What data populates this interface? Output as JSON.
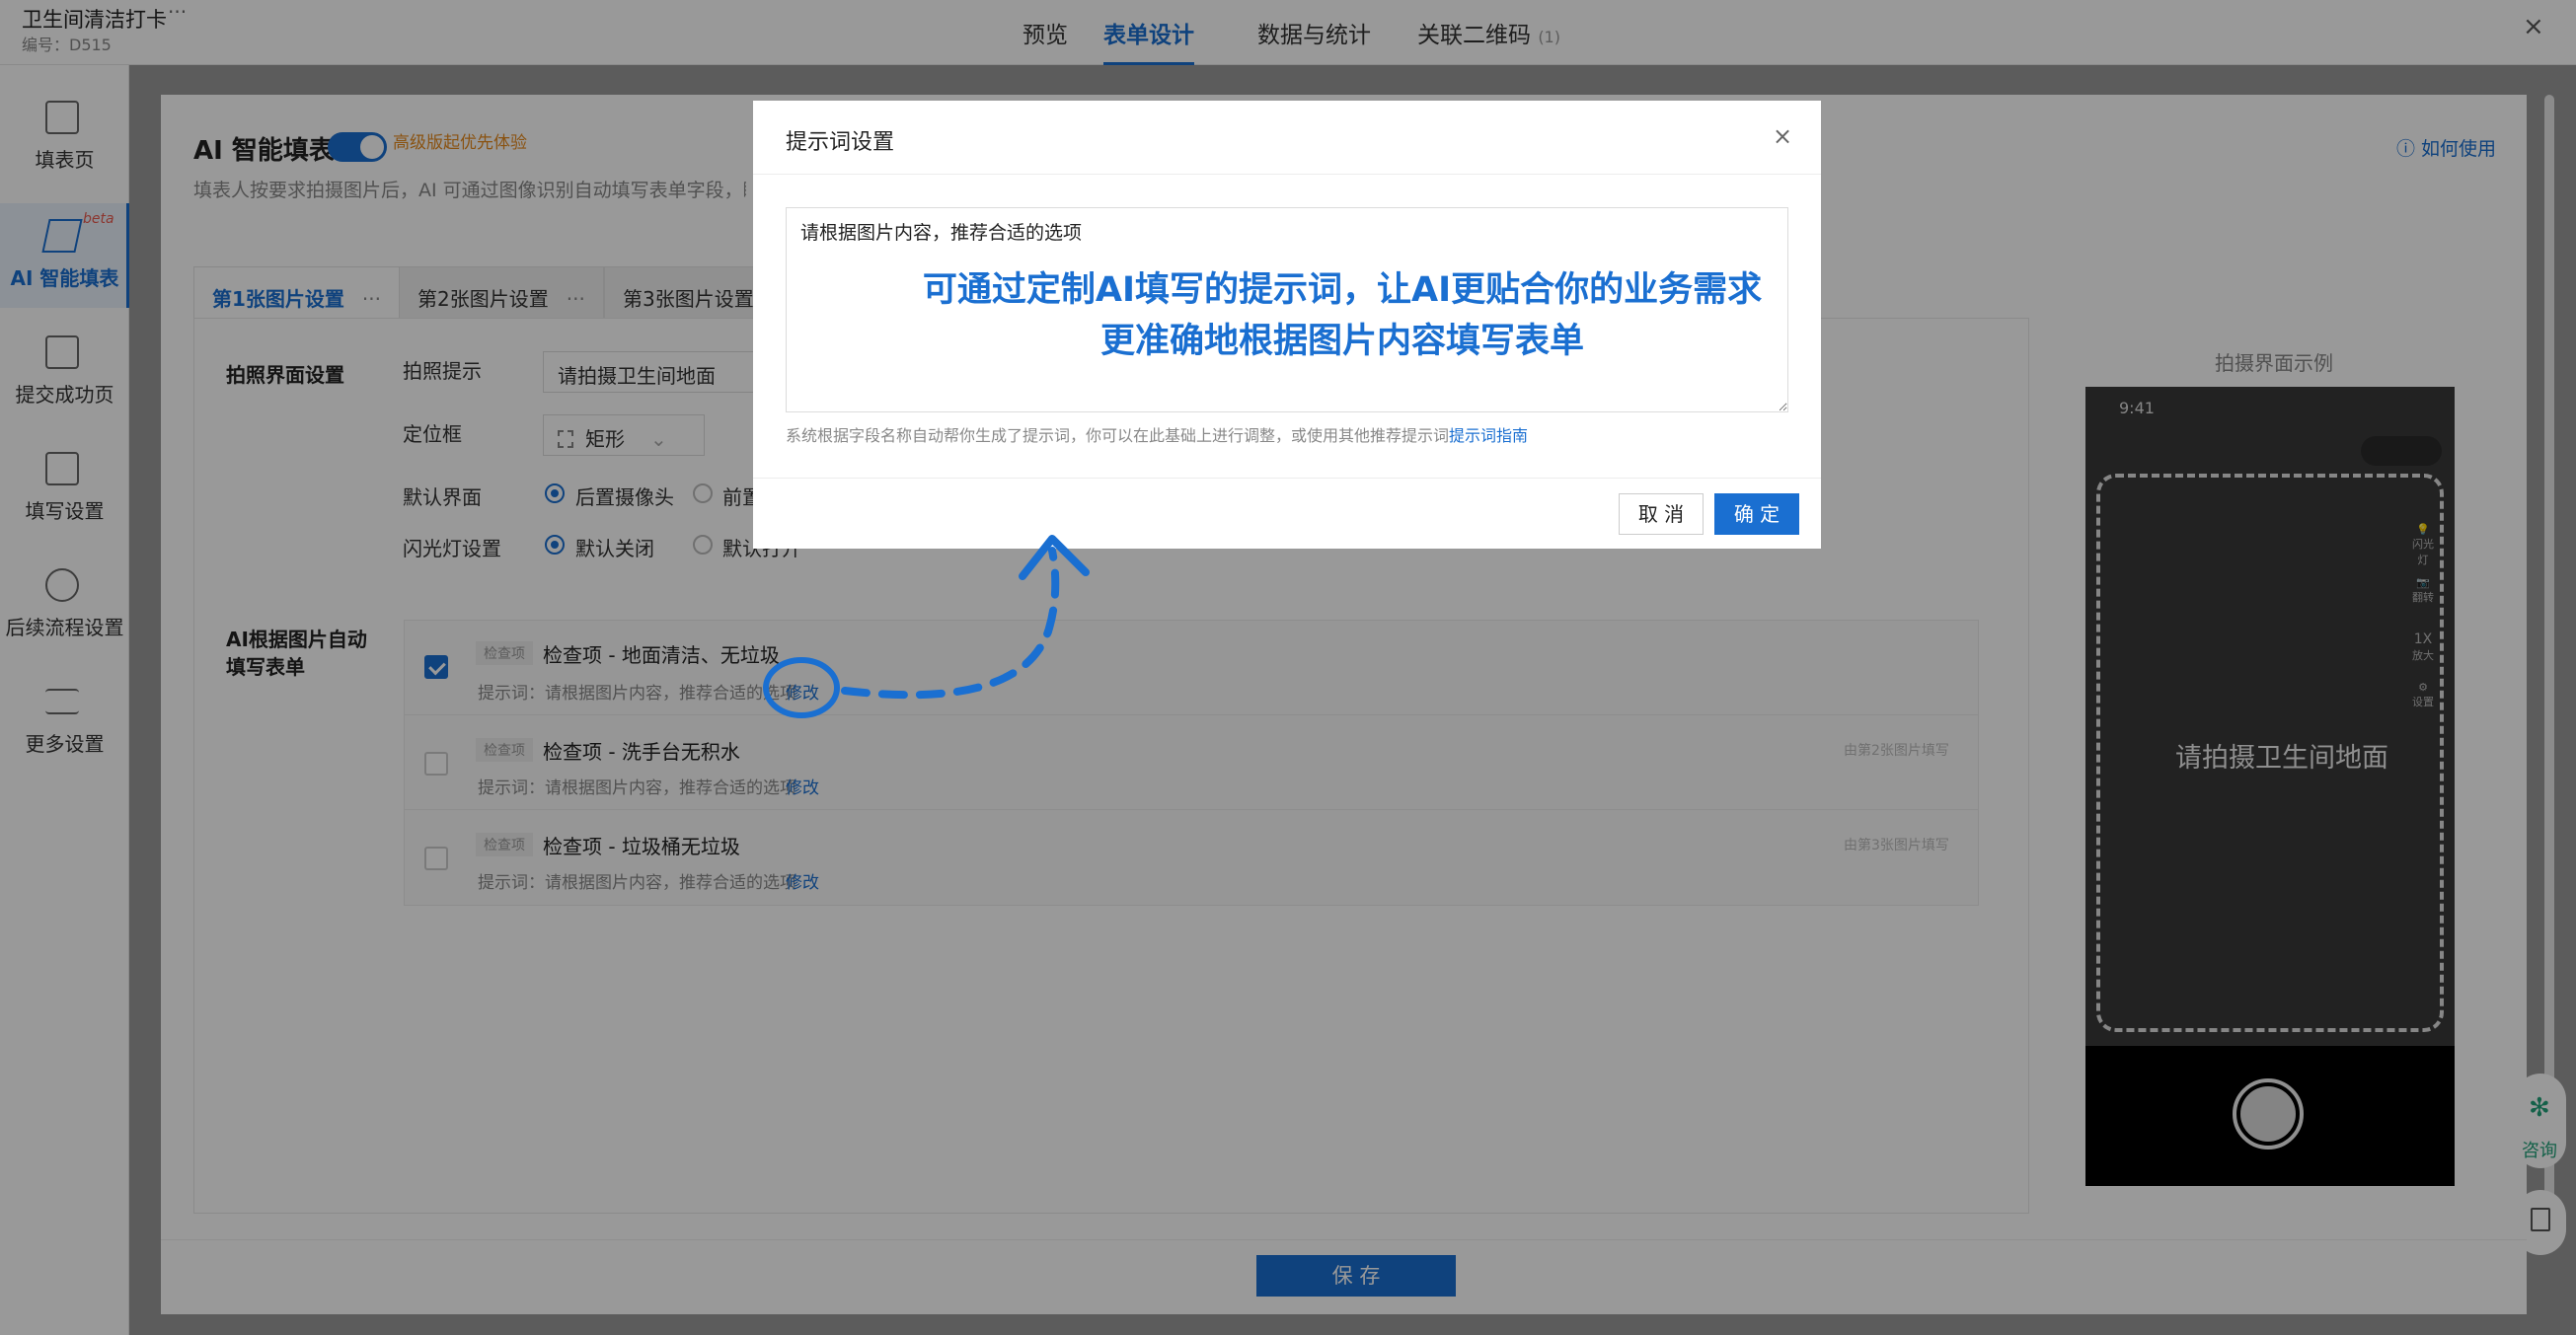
{
  "app": {
    "title": "卫生间清洁打卡",
    "code": "编号：D515",
    "more": "···"
  },
  "nav": {
    "tabs": [
      {
        "label": "预览"
      },
      {
        "label": "表单设计"
      },
      {
        "label": "数据与统计"
      },
      {
        "label": "关联二维码",
        "count": "(1)"
      }
    ],
    "close": "×"
  },
  "sidebar": {
    "items": [
      {
        "label": "填表页"
      },
      {
        "label": "AI 智能填表",
        "badge": "beta"
      },
      {
        "label": "提交成功页"
      },
      {
        "label": "填写设置"
      },
      {
        "label": "后续流程设置"
      },
      {
        "label": "更多设置"
      }
    ]
  },
  "ai_section": {
    "title": "AI 智能填表",
    "toggle_tag": "高级版起优先体验",
    "desc": "填表人按要求拍摄图片后，AI 可通过图像识别自动填写表单字段，瞬",
    "help": "如何使用"
  },
  "image_tabs": [
    {
      "label": "第1张图片设置",
      "dots": "···"
    },
    {
      "label": "第2张图片设置",
      "dots": "···"
    },
    {
      "label": "第3张图片设置"
    }
  ],
  "capture_settings": {
    "section": "拍照界面设置",
    "hint_label": "拍照提示",
    "hint_value": "请拍摄卫生间地面",
    "frame_label": "定位框",
    "frame_value": "矩形",
    "camera_label": "默认界面",
    "camera_opt1": "后置摄像头",
    "camera_opt2": "前置",
    "flash_label": "闪光灯设置",
    "flash_opt1": "默认关闭",
    "flash_opt2": "默认打开"
  },
  "ai_fill": {
    "section_line1": "AI根据图片自动",
    "section_line2": "填写表单",
    "rows": [
      {
        "tag": "检查项",
        "title": "检查项 - 地面清洁、无垃圾",
        "hint": "提示词：请根据图片内容，推荐合适的选项",
        "link": "修改",
        "side": ""
      },
      {
        "tag": "检查项",
        "title": "检查项 - 洗手台无积水",
        "hint": "提示词：请根据图片内容，推荐合适的选项",
        "link": "修改",
        "side": "由第2张图片填写"
      },
      {
        "tag": "检查项",
        "title": "检查项 - 垃圾桶无垃圾",
        "hint": "提示词：请根据图片内容，推荐合适的选项",
        "link": "修改",
        "side": "由第3张图片填写"
      }
    ]
  },
  "preview": {
    "label": "拍摄界面示例",
    "time": "9:41",
    "prompt": "请拍摄卫生间地面",
    "tools": [
      {
        "label": "闪光灯"
      },
      {
        "label": "翻转"
      },
      {
        "label": "1X",
        "sub": "放大"
      },
      {
        "label": "设置"
      }
    ]
  },
  "floating": {
    "consult": "咨询"
  },
  "footer": {
    "save": "保 存"
  },
  "modal": {
    "title": "提示词设置",
    "close": "×",
    "prompt_value": "请根据图片内容，推荐合适的选项",
    "callout_line1": "可通过定制AI填写的提示词，让AI更贴合你的业务需求",
    "callout_line2": "更准确地根据图片内容填写表单",
    "hint": "系统根据字段名称自动帮你生成了提示词，你可以在此基础上进行调整，或使用其他推荐提示词",
    "hint_link": "提示词指南",
    "cancel": "取 消",
    "ok": "确 定"
  },
  "colors": {
    "accent": "#1a6fd1",
    "warning": "#e68a1e",
    "consult": "#22a27a"
  }
}
